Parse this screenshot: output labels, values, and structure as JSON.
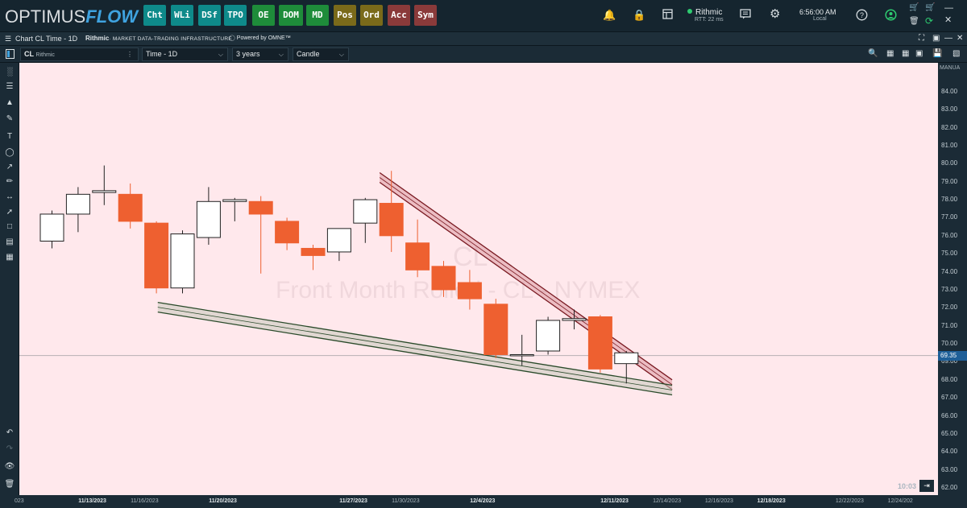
{
  "app": {
    "logo_part1": "OPTIMUS",
    "logo_part2": "FLOW"
  },
  "top": {
    "buttons": [
      {
        "label": "Cht",
        "bg": "#0e8a8a"
      },
      {
        "label": "WLi",
        "bg": "#0e8a8a"
      },
      {
        "label": "DSf",
        "bg": "#0e8a8a"
      },
      {
        "label": "TPO",
        "bg": "#0e8a8a"
      },
      {
        "label": "OE",
        "bg": "#1e8c3a"
      },
      {
        "label": "DOM",
        "bg": "#1e8c3a"
      },
      {
        "label": "MD",
        "bg": "#1e8c3a"
      },
      {
        "label": "Pos",
        "bg": "#7a6a1a"
      },
      {
        "label": "Ord",
        "bg": "#7a6a1a"
      },
      {
        "label": "Acc",
        "bg": "#8a3a3a"
      },
      {
        "label": "Sym",
        "bg": "#8a3a3a"
      }
    ],
    "connection_name": "Rithmic",
    "rtt": "RTT: 22 ms",
    "time": "6:56:00 AM",
    "timezone": "Local"
  },
  "subheader": {
    "title": "Chart CL Time - 1D",
    "rithmic": "Rithmic",
    "rithmic_tag": "· MARKET DATA-TRADING INFRASTRUCTURE",
    "omne": "Powered by OMNE™"
  },
  "toolbar": {
    "symbol": "CL",
    "symbol_source": "Rithmic",
    "timeframe": "Time - 1D",
    "range": "3 years",
    "chart_type": "Candle"
  },
  "watermark": {
    "symbol": "CL",
    "description": "Front Month Rolled - CL - NYMEX"
  },
  "chart": {
    "axis_mode": "MANUA",
    "last_price_label": "69.35",
    "countdown": "10:03",
    "colors": {
      "up_fill": "#ffffff",
      "down_fill": "#ee6030",
      "background": "#ffe8ec",
      "resistance": "#7a1a22",
      "support": "#2a4a2a"
    }
  },
  "chart_data": {
    "type": "candlestick",
    "last_price": 69.35,
    "ylim": [
      61.6,
      85.6
    ],
    "y_ticks": [
      "84.00",
      "83.00",
      "82.00",
      "81.00",
      "80.00",
      "79.00",
      "78.00",
      "77.00",
      "76.00",
      "75.00",
      "74.00",
      "73.00",
      "72.00",
      "71.00",
      "70.00",
      "69.00",
      "68.00",
      "67.00",
      "66.00",
      "65.00",
      "64.00",
      "63.00",
      "62.00"
    ],
    "x_ticks": [
      {
        "label": "023",
        "i": -2.8
      },
      {
        "label": "11/13/2023",
        "i": 2.2
      },
      {
        "label": "11/16/2023",
        "i": 4.2
      },
      {
        "label": "11/20/2023",
        "i": 7.2
      },
      {
        "label": "11/27/2023",
        "i": 12.2
      },
      {
        "label": "11/30/2023",
        "i": 14.2
      },
      {
        "label": "12/4/2023",
        "i": 17.2
      },
      {
        "label": "12/11/2023",
        "i": 22.2
      },
      {
        "label": "12/14/2023",
        "i": 24.2
      },
      {
        "label": "12/16/2023",
        "i": 26.2
      },
      {
        "label": "12/18/2023",
        "i": 28.2
      },
      {
        "label": "12/22/2023",
        "i": 31.2
      },
      {
        "label": "12/24/202",
        "i": 33.2
      }
    ],
    "candles": [
      {
        "o": 75.7,
        "h": 77.4,
        "l": 75.3,
        "c": 77.2
      },
      {
        "o": 77.2,
        "h": 78.7,
        "l": 76.2,
        "c": 78.3
      },
      {
        "o": 78.4,
        "h": 79.9,
        "l": 77.7,
        "c": 78.5
      },
      {
        "o": 78.3,
        "h": 78.9,
        "l": 76.4,
        "c": 76.8
      },
      {
        "o": 76.7,
        "h": 76.8,
        "l": 72.8,
        "c": 73.1
      },
      {
        "o": 73.1,
        "h": 76.3,
        "l": 72.8,
        "c": 76.1
      },
      {
        "o": 75.9,
        "h": 78.7,
        "l": 75.5,
        "c": 77.9
      },
      {
        "o": 77.9,
        "h": 78.1,
        "l": 76.8,
        "c": 78.0
      },
      {
        "o": 77.9,
        "h": 78.2,
        "l": 73.9,
        "c": 77.2
      },
      {
        "o": 76.8,
        "h": 77.0,
        "l": 75.2,
        "c": 75.6
      },
      {
        "o": 75.3,
        "h": 75.5,
        "l": 74.1,
        "c": 74.9
      },
      {
        "o": 75.1,
        "h": 76.4,
        "l": 74.6,
        "c": 76.4
      },
      {
        "o": 76.7,
        "h": 78.1,
        "l": 75.6,
        "c": 78.0
      },
      {
        "o": 77.8,
        "h": 79.6,
        "l": 75.1,
        "c": 76.0
      },
      {
        "o": 75.6,
        "h": 76.9,
        "l": 73.7,
        "c": 74.1
      },
      {
        "o": 74.3,
        "h": 74.6,
        "l": 72.6,
        "c": 73.0
      },
      {
        "o": 73.4,
        "h": 74.1,
        "l": 71.9,
        "c": 72.5
      },
      {
        "o": 72.2,
        "h": 72.5,
        "l": 69.2,
        "c": 69.4
      },
      {
        "o": 69.4,
        "h": 70.5,
        "l": 68.8,
        "c": 69.4
      },
      {
        "o": 69.6,
        "h": 71.5,
        "l": 69.4,
        "c": 71.3
      },
      {
        "o": 71.3,
        "h": 71.9,
        "l": 70.8,
        "c": 71.4
      },
      {
        "o": 71.5,
        "h": 71.6,
        "l": 68.4,
        "c": 68.6
      },
      {
        "o": 68.9,
        "h": 69.6,
        "l": 67.8,
        "c": 69.5
      }
    ],
    "trend_lines": [
      {
        "name": "resistance",
        "from": {
          "i": 13.0,
          "y": 79.5
        },
        "to": {
          "i": 24.2,
          "y": 68.0
        }
      },
      {
        "name": "support",
        "from": {
          "i": 4.5,
          "y": 72.3
        },
        "to": {
          "i": 24.2,
          "y": 67.7
        }
      }
    ]
  }
}
